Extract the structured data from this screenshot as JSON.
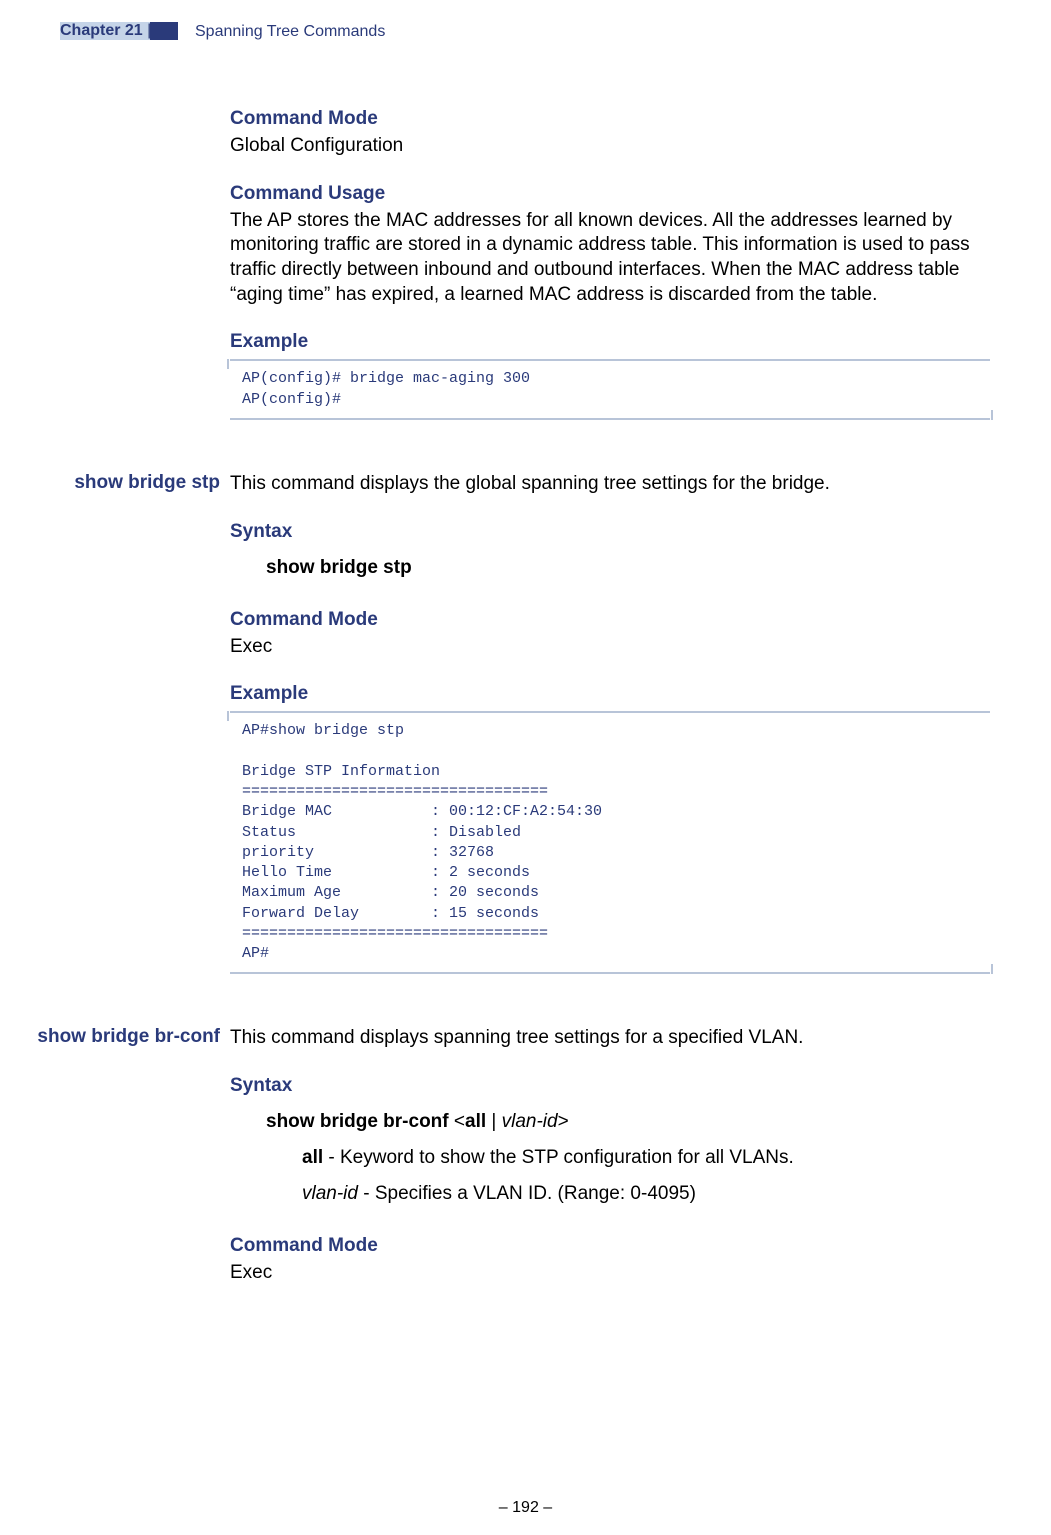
{
  "header": {
    "chapter_label": "Chapter 21",
    "chapter_title": "Spanning Tree Commands"
  },
  "section1": {
    "command_mode_heading": "Command Mode",
    "command_mode_text": "Global Configuration",
    "command_usage_heading": "Command Usage",
    "command_usage_text": "The AP stores the MAC addresses for all known devices. All the addresses learned by monitoring traffic are stored in a dynamic address table. This information is used to pass traffic directly between inbound and outbound interfaces. When the MAC address table “aging time” has expired, a learned MAC address is discarded from the table.",
    "example_heading": "Example",
    "example_code": "AP(config)# bridge mac-aging 300\nAP(config)#"
  },
  "section2": {
    "side_label": "show bridge stp",
    "description": "This command displays the global spanning tree settings for the bridge.",
    "syntax_heading": "Syntax",
    "syntax_text": "show bridge stp",
    "command_mode_heading": "Command Mode",
    "command_mode_text": "Exec",
    "example_heading": "Example",
    "example_code": "AP#show bridge stp\n\nBridge STP Information\n==================================\nBridge MAC           : 00:12:CF:A2:54:30\nStatus               : Disabled\npriority             : 32768\nHello Time           : 2 seconds\nMaximum Age          : 20 seconds\nForward Delay        : 15 seconds\n==================================\nAP#"
  },
  "section3": {
    "side_label": "show bridge br-conf",
    "description": "This command displays spanning tree settings for a specified VLAN.",
    "syntax_heading": "Syntax",
    "syntax_command_prefix": "show bridge br-conf ",
    "syntax_angle_open": "<",
    "syntax_all": "all",
    "syntax_pipe": " | ",
    "syntax_vlanid": "vlan-id",
    "syntax_angle_close": ">",
    "param_all_bold": "all",
    "param_all_text": " - Keyword to show the STP configuration for all VLANs.",
    "param_vlan_italic": "vlan-id",
    "param_vlan_text": " - Specifies a VLAN ID. (Range: 0-4095)",
    "command_mode_heading": "Command Mode",
    "command_mode_text": "Exec"
  },
  "footer": {
    "page_number": "–  192  –"
  }
}
